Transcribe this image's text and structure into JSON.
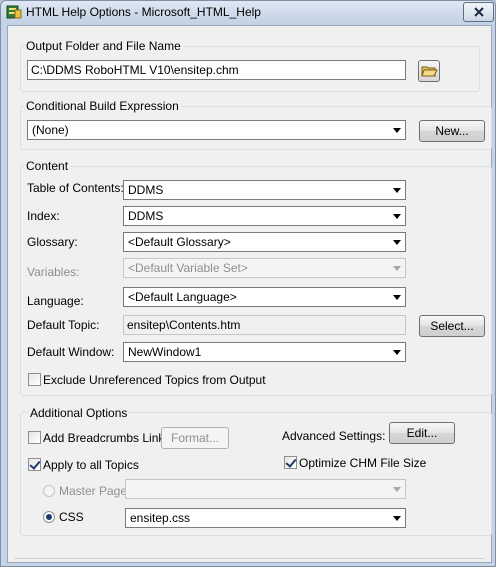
{
  "window": {
    "title": "HTML Help Options - Microsoft_HTML_Help"
  },
  "output": {
    "group_label": "Output Folder and File Name",
    "path_value": "C:\\DDMS RoboHTML V10\\ensitep.chm"
  },
  "conditional": {
    "group_label": "Conditional Build Expression",
    "expression_value": "(None)",
    "new_button": "New..."
  },
  "content": {
    "group_label": "Content",
    "toc_label": "Table of Contents:",
    "toc_value": "DDMS",
    "index_label": "Index:",
    "index_value": "DDMS",
    "glossary_label": "Glossary:",
    "glossary_value": "<Default Glossary>",
    "variables_label": "Variables:",
    "variables_value": "<Default Variable Set>",
    "language_label": "Language:",
    "language_value": "<Default Language>",
    "default_topic_label": "Default Topic:",
    "default_topic_value": "ensitep\\Contents.htm",
    "select_button": "Select...",
    "default_window_label": "Default Window:",
    "default_window_value": "NewWindow1",
    "exclude_label": "Exclude Unreferenced Topics from Output",
    "exclude_checked": false
  },
  "additional": {
    "group_label": "Additional Options",
    "breadcrumbs_label": "Add Breadcrumbs Links",
    "breadcrumbs_checked": false,
    "format_button": "Format...",
    "advanced_label": "Advanced Settings:",
    "edit_button": "Edit...",
    "apply_all_label": "Apply to all Topics",
    "apply_all_checked": true,
    "optimize_label": "Optimize CHM File Size",
    "optimize_checked": true,
    "master_page_label": "Master Page",
    "master_page_value": "",
    "css_label": "CSS",
    "css_value": "ensitep.css",
    "css_selected": true
  }
}
